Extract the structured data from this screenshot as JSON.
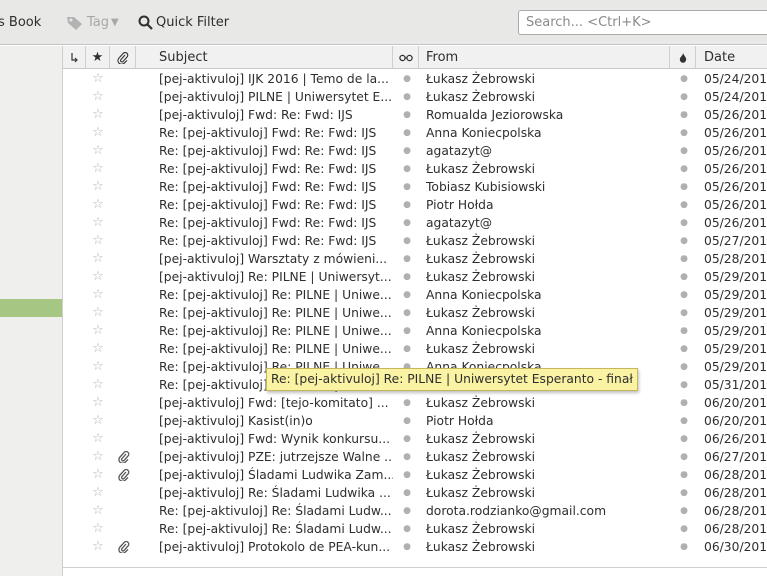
{
  "toolbar": {
    "address_book_label": "s Book",
    "tag_label": "Tag",
    "quick_filter_label": "Quick Filter",
    "search_placeholder": "Search... <Ctrl+K>"
  },
  "columns": {
    "subject": "Subject",
    "from": "From",
    "date": "Date"
  },
  "messages": [
    {
      "subject": "[pej-aktivuloj] IJK 2016 | Temo de la...",
      "from": "Łukasz Żebrowski",
      "date": "05/24/201",
      "attachment": false
    },
    {
      "subject": "[pej-aktivuloj] PILNE | Uniwersytet E...",
      "from": "Łukasz Żebrowski",
      "date": "05/24/201",
      "attachment": false
    },
    {
      "subject": "[pej-aktivuloj] Fwd: Re: Fwd: IJS",
      "from": "Romualda Jeziorowska",
      "date": "05/26/201",
      "attachment": false
    },
    {
      "subject": "Re: [pej-aktivuloj] Fwd: Re: Fwd: IJS",
      "from": "Anna Koniecpolska",
      "date": "05/26/201",
      "attachment": false
    },
    {
      "subject": "Re: [pej-aktivuloj] Fwd: Re: Fwd: IJS",
      "from": "agatazyt@",
      "date": "05/26/201",
      "attachment": false
    },
    {
      "subject": "Re: [pej-aktivuloj] Fwd: Re: Fwd: IJS",
      "from": "Łukasz Żebrowski",
      "date": "05/26/201",
      "attachment": false
    },
    {
      "subject": "Re: [pej-aktivuloj] Fwd: Re: Fwd: IJS",
      "from": "Tobiasz Kubisiowski",
      "date": "05/26/201",
      "attachment": false
    },
    {
      "subject": "Re: [pej-aktivuloj] Fwd: Re: Fwd: IJS",
      "from": "Piotr Hołda",
      "date": "05/26/201",
      "attachment": false
    },
    {
      "subject": "Re: [pej-aktivuloj] Fwd: Re: Fwd: IJS",
      "from": "agatazyt@",
      "date": "05/26/201",
      "attachment": false
    },
    {
      "subject": "Re: [pej-aktivuloj] Fwd: Re: Fwd: IJS",
      "from": "Łukasz Żebrowski",
      "date": "05/27/201",
      "attachment": false
    },
    {
      "subject": "[pej-aktivuloj] Warsztaty z mówieni...",
      "from": "Łukasz Żebrowski",
      "date": "05/28/201",
      "attachment": false
    },
    {
      "subject": "[pej-aktivuloj] Re: PILNE | Uniwersyt...",
      "from": "Łukasz Żebrowski",
      "date": "05/29/201",
      "attachment": false
    },
    {
      "subject": "Re: [pej-aktivuloj] Re: PILNE | Uniwe...",
      "from": "Anna Koniecpolska",
      "date": "05/29/201",
      "attachment": false
    },
    {
      "subject": "Re: [pej-aktivuloj] Re: PILNE | Uniwe...",
      "from": "Łukasz Żebrowski",
      "date": "05/29/201",
      "attachment": false
    },
    {
      "subject": "Re: [pej-aktivuloj] Re: PILNE | Uniwe...",
      "from": "Anna Koniecpolska",
      "date": "05/29/201",
      "attachment": false
    },
    {
      "subject": "Re: [pej-aktivuloj] Re: PILNE | Uniwe...",
      "from": "Łukasz Żebrowski",
      "date": "05/29/201",
      "attachment": false
    },
    {
      "subject": "Re: [pej-aktivuloj] Re: PILNE | Uniwe...",
      "from": "Anna Koniecpolska",
      "date": "05/29/201",
      "attachment": false
    },
    {
      "subject": "Re: [pej-aktivuloj] Re: PILNE | Uniwe...",
      "from": "",
      "date": "05/31/201",
      "attachment": false
    },
    {
      "subject": "[pej-aktivuloj] Fwd: [tejo-komitato] ...",
      "from": "Łukasz Żebrowski",
      "date": "06/20/201",
      "attachment": false
    },
    {
      "subject": "[pej-aktivuloj] Kasist(in)o",
      "from": "Piotr Hołda",
      "date": "06/20/201",
      "attachment": false
    },
    {
      "subject": "[pej-aktivuloj] Fwd: Wynik konkursu...",
      "from": "Łukasz Żebrowski",
      "date": "06/26/201",
      "attachment": false
    },
    {
      "subject": "[pej-aktivuloj] PZE: jutrzejsze Walne ...",
      "from": "Łukasz Żebrowski",
      "date": "06/27/201",
      "attachment": true
    },
    {
      "subject": "[pej-aktivuloj] Śladami Ludwika Zam...",
      "from": "Łukasz Żebrowski",
      "date": "06/28/201",
      "attachment": true
    },
    {
      "subject": "[pej-aktivuloj] Re: Śladami Ludwika ...",
      "from": "Łukasz Żebrowski",
      "date": "06/28/201",
      "attachment": false
    },
    {
      "subject": "Re: [pej-aktivuloj] Re: Śladami Ludw...",
      "from": "dorota.rodzianko@gmail.com",
      "date": "06/28/201",
      "attachment": false
    },
    {
      "subject": "Re: [pej-aktivuloj] Re: Śladami Ludw...",
      "from": "Łukasz Żebrowski",
      "date": "06/28/201",
      "attachment": false
    },
    {
      "subject": "[pej-aktivuloj] Protokolo de PEA-kun...",
      "from": "Łukasz Żebrowski",
      "date": "06/30/201",
      "attachment": true
    }
  ],
  "tooltip": {
    "text": "Re: [pej-aktivuloj] Re: PILNE | Uniwersytet Esperanto - finał"
  },
  "icons": {
    "thread": "thread-icon",
    "star": "star-icon",
    "attachment": "paperclip-icon",
    "read": "read-status-icon",
    "junk": "junk-icon"
  },
  "colors": {
    "selected_folder": "#a6c783",
    "tooltip_bg": "#fbf3a4"
  }
}
